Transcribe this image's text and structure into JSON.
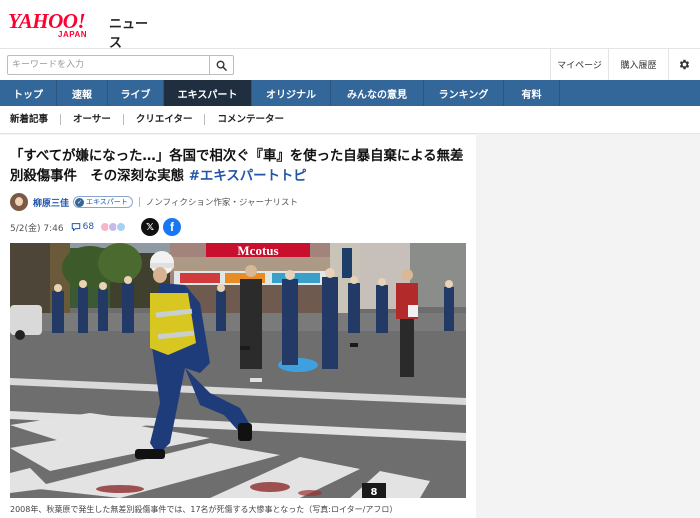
{
  "header": {
    "logo_yahoo": "YAHOO!",
    "logo_japan": "JAPAN",
    "logo_service": "ニュース",
    "search_placeholder": "キーワードを入力",
    "mypage": "マイページ",
    "history": "購入履歴",
    "search_icon": "magnifier-icon",
    "settings_icon": "gear-icon"
  },
  "nav": {
    "items": [
      "トップ",
      "速報",
      "ライブ",
      "エキスパート",
      "オリジナル",
      "みんなの意見",
      "ランキング",
      "有料"
    ],
    "active_index": 3
  },
  "subnav": {
    "items": [
      "新着記事",
      "オーサー",
      "クリエイター",
      "コメンテーター"
    ]
  },
  "article": {
    "title_main": "「すべてが嫌になった…」各国で相次ぐ『車』を使った自暴自棄による無差別殺傷事件　その深刻な実態 ",
    "title_tag": "#エキスパートトピ",
    "author_name": "柳原三佳",
    "author_badge": "エキスパート",
    "author_title": "ノンフィクション作家・ジャーナリスト",
    "datetime": "5/2(金) 7:46",
    "comment_count": "68",
    "photo_caption": "2008年、秋葉原で発生した無差別殺傷事件では、17名が死傷する大惨事となった（写真:ロイター/アフロ）",
    "photo_store_sign": "Mcotus",
    "photo_corner_label": "8"
  },
  "colors": {
    "nav_bg": "#336699",
    "nav_active": "#1f2f40",
    "link_blue": "#2255aa",
    "brand_red": "#ff0033"
  }
}
